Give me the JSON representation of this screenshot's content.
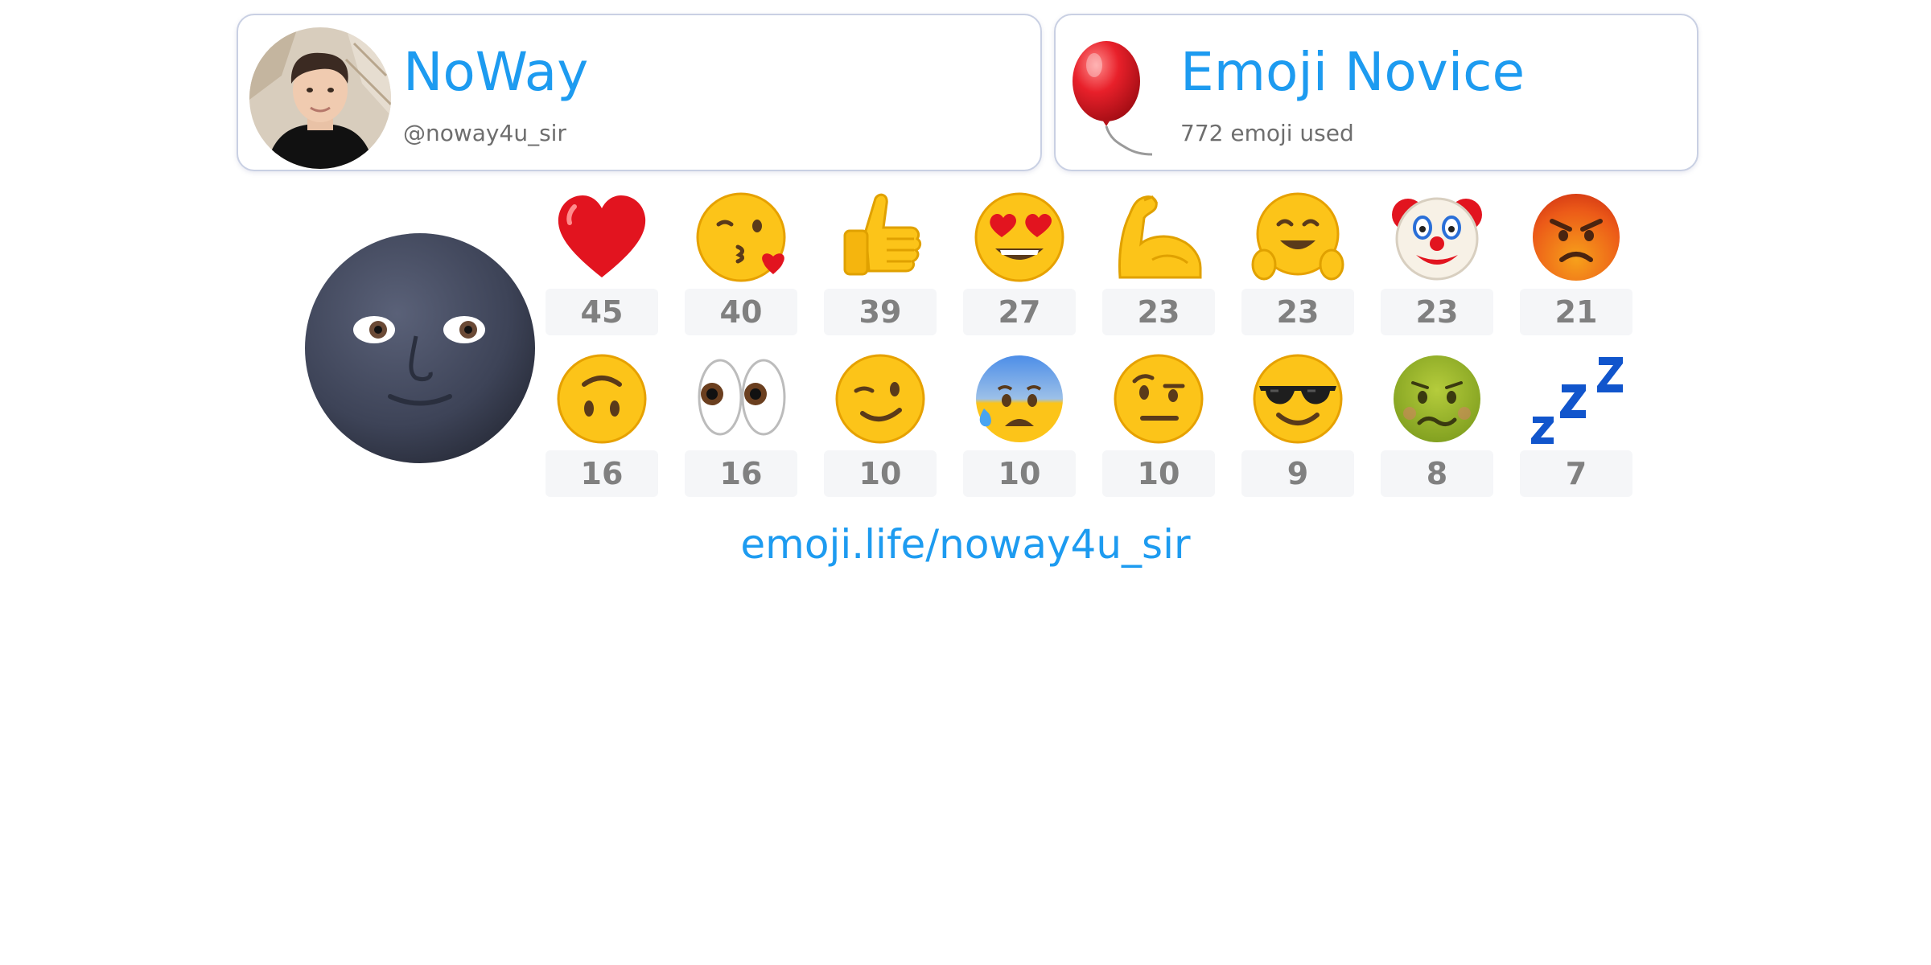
{
  "profile": {
    "display_name": "NoWay",
    "handle": "@noway4u_sir"
  },
  "rank": {
    "title": "Emoji Novice",
    "usage_text": "772 emoji used",
    "icon": "red-balloon-icon"
  },
  "top_emoji": {
    "icon": "new-moon-face-icon"
  },
  "emoji_stats": [
    {
      "icon": "red-heart-icon",
      "count": "45"
    },
    {
      "icon": "face-blowing-kiss-icon",
      "count": "40"
    },
    {
      "icon": "thumbs-up-icon",
      "count": "39"
    },
    {
      "icon": "heart-eyes-icon",
      "count": "27"
    },
    {
      "icon": "flexed-biceps-icon",
      "count": "23"
    },
    {
      "icon": "hugging-face-icon",
      "count": "23"
    },
    {
      "icon": "clown-face-icon",
      "count": "23"
    },
    {
      "icon": "angry-face-icon",
      "count": "21"
    },
    {
      "icon": "upside-down-face-icon",
      "count": "16"
    },
    {
      "icon": "eyes-icon",
      "count": "16"
    },
    {
      "icon": "winking-face-icon",
      "count": "10"
    },
    {
      "icon": "anxious-sweat-face-icon",
      "count": "10"
    },
    {
      "icon": "raised-eyebrow-face-icon",
      "count": "10"
    },
    {
      "icon": "sunglasses-face-icon",
      "count": "9"
    },
    {
      "icon": "nauseated-face-icon",
      "count": "8"
    },
    {
      "icon": "zzz-icon",
      "count": "7"
    }
  ],
  "footer": {
    "link_text": "emoji.life/noway4u_sir"
  },
  "colors": {
    "accent": "#1d9bf0",
    "count_text": "#808080",
    "count_bg": "#f5f6f8",
    "card_border": "#c9d0e3"
  }
}
